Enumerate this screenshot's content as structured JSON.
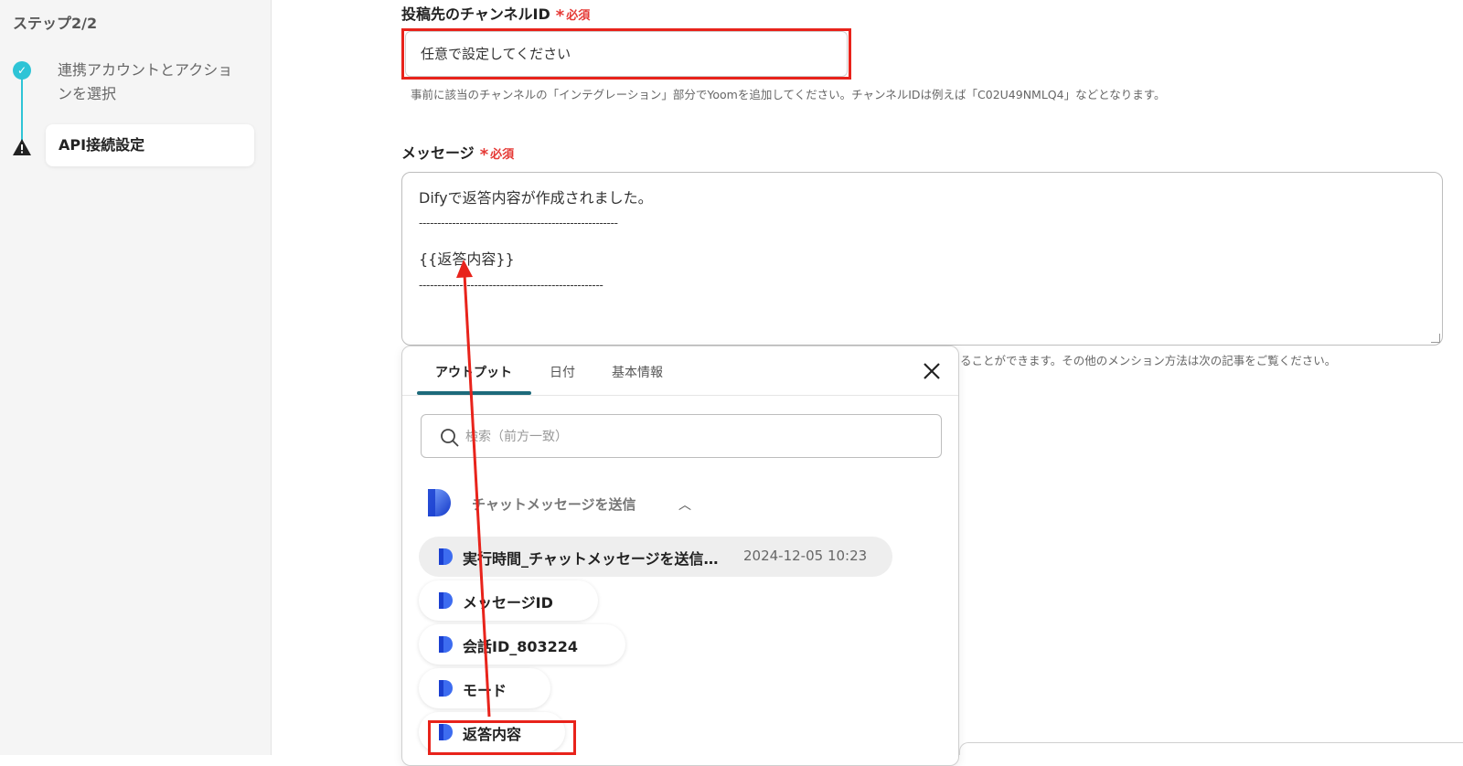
{
  "sidebar": {
    "step_header": "ステップ2/2",
    "step1_label": "連携アカウントとアクションを選択",
    "step2_label": "API接続設定"
  },
  "channel_field": {
    "label": "投稿先のチャンネルID",
    "required": "必須",
    "value": "任意で設定してください",
    "hint": "事前に該当のチャンネルの「インテグレーション」部分でYoomを追加してください。チャンネルIDは例えば「C02U49NMLQ4」などとなります。"
  },
  "message_field": {
    "label": "メッセージ",
    "required": "必須",
    "lines": [
      "Difyで返答内容が作成されました。",
      "------------------------------------------------------",
      "{{返答内容}}",
      "--------------------------------------------------"
    ],
    "hint_partial": "ることができます。その他のメンション方法は次の記事をご覧ください。"
  },
  "popup": {
    "tabs": [
      "アウトプット",
      "日付",
      "基本情報"
    ],
    "search_placeholder": "検索（前方一致）",
    "group_label": "チャットメッセージを送信",
    "items": [
      {
        "label": "実行時間_チャットメッセージを送信…",
        "value": "2024-12-05 10:23"
      },
      {
        "label": "メッセージID",
        "value": ""
      },
      {
        "label": "会話ID_803224",
        "value": ""
      },
      {
        "label": "モード",
        "value": ""
      },
      {
        "label": "返答内容",
        "value": ""
      }
    ]
  },
  "colors": {
    "accent": "#2ec4d6",
    "required_red": "#e53935",
    "highlight_red": "#e8231b",
    "tab_underline": "#1d6a7b",
    "dify_blue": "#1a4fd6"
  }
}
